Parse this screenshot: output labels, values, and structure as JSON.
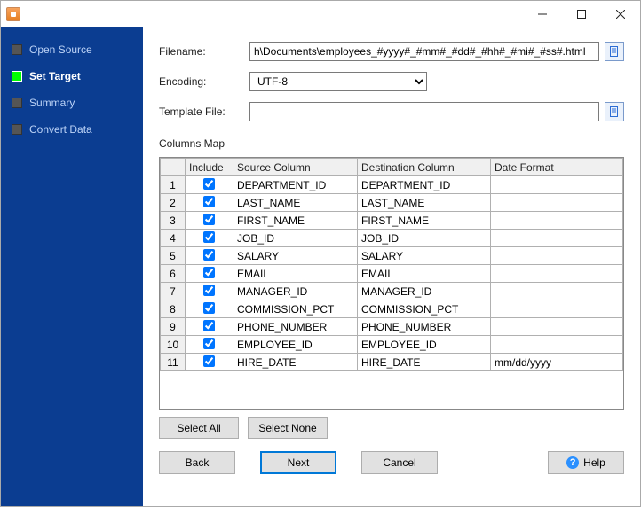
{
  "titlebar": {
    "title": ""
  },
  "sidebar": {
    "steps": [
      {
        "label": "Open Source",
        "active": false
      },
      {
        "label": "Set Target",
        "active": true
      },
      {
        "label": "Summary",
        "active": false
      },
      {
        "label": "Convert Data",
        "active": false
      }
    ]
  },
  "form": {
    "filename_label": "Filename:",
    "filename_value": "h\\Documents\\employees_#yyyy#_#mm#_#dd#_#hh#_#mi#_#ss#.html",
    "encoding_label": "Encoding:",
    "encoding_value": "UTF-8",
    "template_label": "Template File:",
    "template_value": "",
    "columns_label": "Columns Map"
  },
  "table": {
    "headers": {
      "include": "Include",
      "source": "Source Column",
      "dest": "Destination Column",
      "fmt": "Date Format"
    },
    "rows": [
      {
        "n": "1",
        "inc": true,
        "src": "DEPARTMENT_ID",
        "dst": "DEPARTMENT_ID",
        "fmt": ""
      },
      {
        "n": "2",
        "inc": true,
        "src": "LAST_NAME",
        "dst": "LAST_NAME",
        "fmt": ""
      },
      {
        "n": "3",
        "inc": true,
        "src": "FIRST_NAME",
        "dst": "FIRST_NAME",
        "fmt": ""
      },
      {
        "n": "4",
        "inc": true,
        "src": "JOB_ID",
        "dst": "JOB_ID",
        "fmt": ""
      },
      {
        "n": "5",
        "inc": true,
        "src": "SALARY",
        "dst": "SALARY",
        "fmt": ""
      },
      {
        "n": "6",
        "inc": true,
        "src": "EMAIL",
        "dst": "EMAIL",
        "fmt": ""
      },
      {
        "n": "7",
        "inc": true,
        "src": "MANAGER_ID",
        "dst": "MANAGER_ID",
        "fmt": ""
      },
      {
        "n": "8",
        "inc": true,
        "src": "COMMISSION_PCT",
        "dst": "COMMISSION_PCT",
        "fmt": ""
      },
      {
        "n": "9",
        "inc": true,
        "src": "PHONE_NUMBER",
        "dst": "PHONE_NUMBER",
        "fmt": ""
      },
      {
        "n": "10",
        "inc": true,
        "src": "EMPLOYEE_ID",
        "dst": "EMPLOYEE_ID",
        "fmt": ""
      },
      {
        "n": "11",
        "inc": true,
        "src": "HIRE_DATE",
        "dst": "HIRE_DATE",
        "fmt": "mm/dd/yyyy"
      }
    ]
  },
  "buttons": {
    "select_all": "Select All",
    "select_none": "Select None",
    "back": "Back",
    "next": "Next",
    "cancel": "Cancel",
    "help": "Help"
  }
}
